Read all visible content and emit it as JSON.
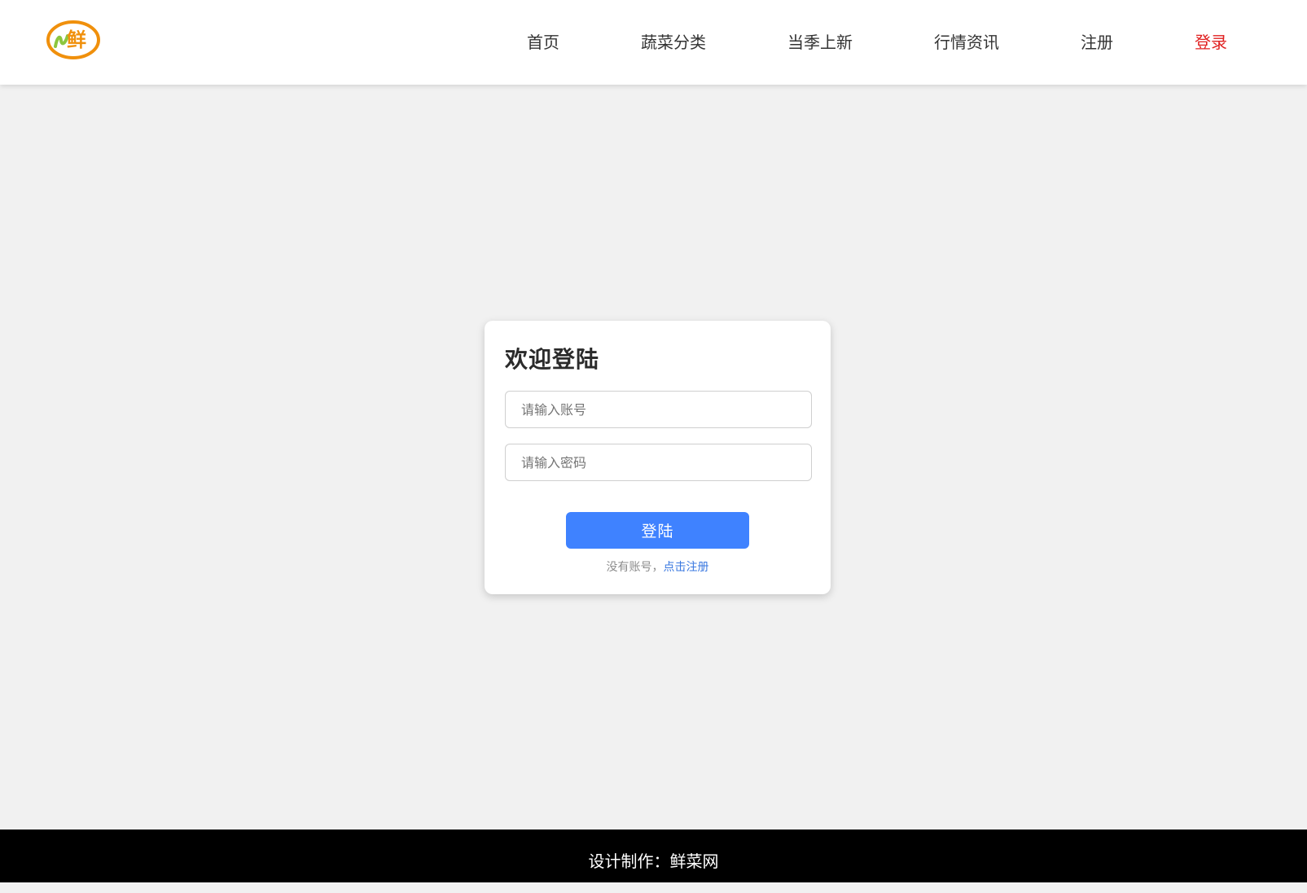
{
  "logo": {
    "text": "鲜",
    "accent_color": "#f0900c",
    "leaf_color": "#8cc63f"
  },
  "nav": {
    "items": [
      {
        "label": "首页"
      },
      {
        "label": "蔬菜分类"
      },
      {
        "label": "当季上新"
      },
      {
        "label": "行情资讯"
      },
      {
        "label": "注册"
      },
      {
        "label": "登录",
        "active": true
      }
    ],
    "active_color": "#e02020"
  },
  "login": {
    "title": "欢迎登陆",
    "account_placeholder": "请输入账号",
    "password_placeholder": "请输入密码",
    "submit_label": "登陆",
    "no_account_text": "没有账号，",
    "register_link": "点击注册",
    "button_color": "#3f82ff"
  },
  "footer": {
    "text": "设计制作：鲜菜网"
  }
}
